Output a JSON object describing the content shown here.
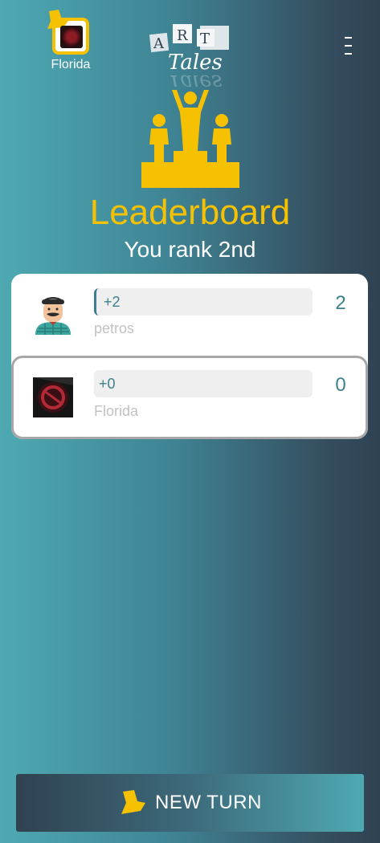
{
  "header": {
    "profile_name": "Florida",
    "logo_letters": [
      "A",
      "R",
      "T"
    ],
    "logo_script": "Tales",
    "menu_icon": "more-vertical-icon"
  },
  "leaderboard": {
    "title": "Leaderboard",
    "rank_text": "You rank 2nd",
    "rows": [
      {
        "delta": "+2",
        "name": "petros",
        "score": "2"
      },
      {
        "delta": "+0",
        "name": "Florida",
        "score": "0"
      }
    ]
  },
  "footer": {
    "new_turn_label": "NEW TURN"
  },
  "colors": {
    "accent": "#f5c100",
    "teal": "#3e7f8d"
  }
}
